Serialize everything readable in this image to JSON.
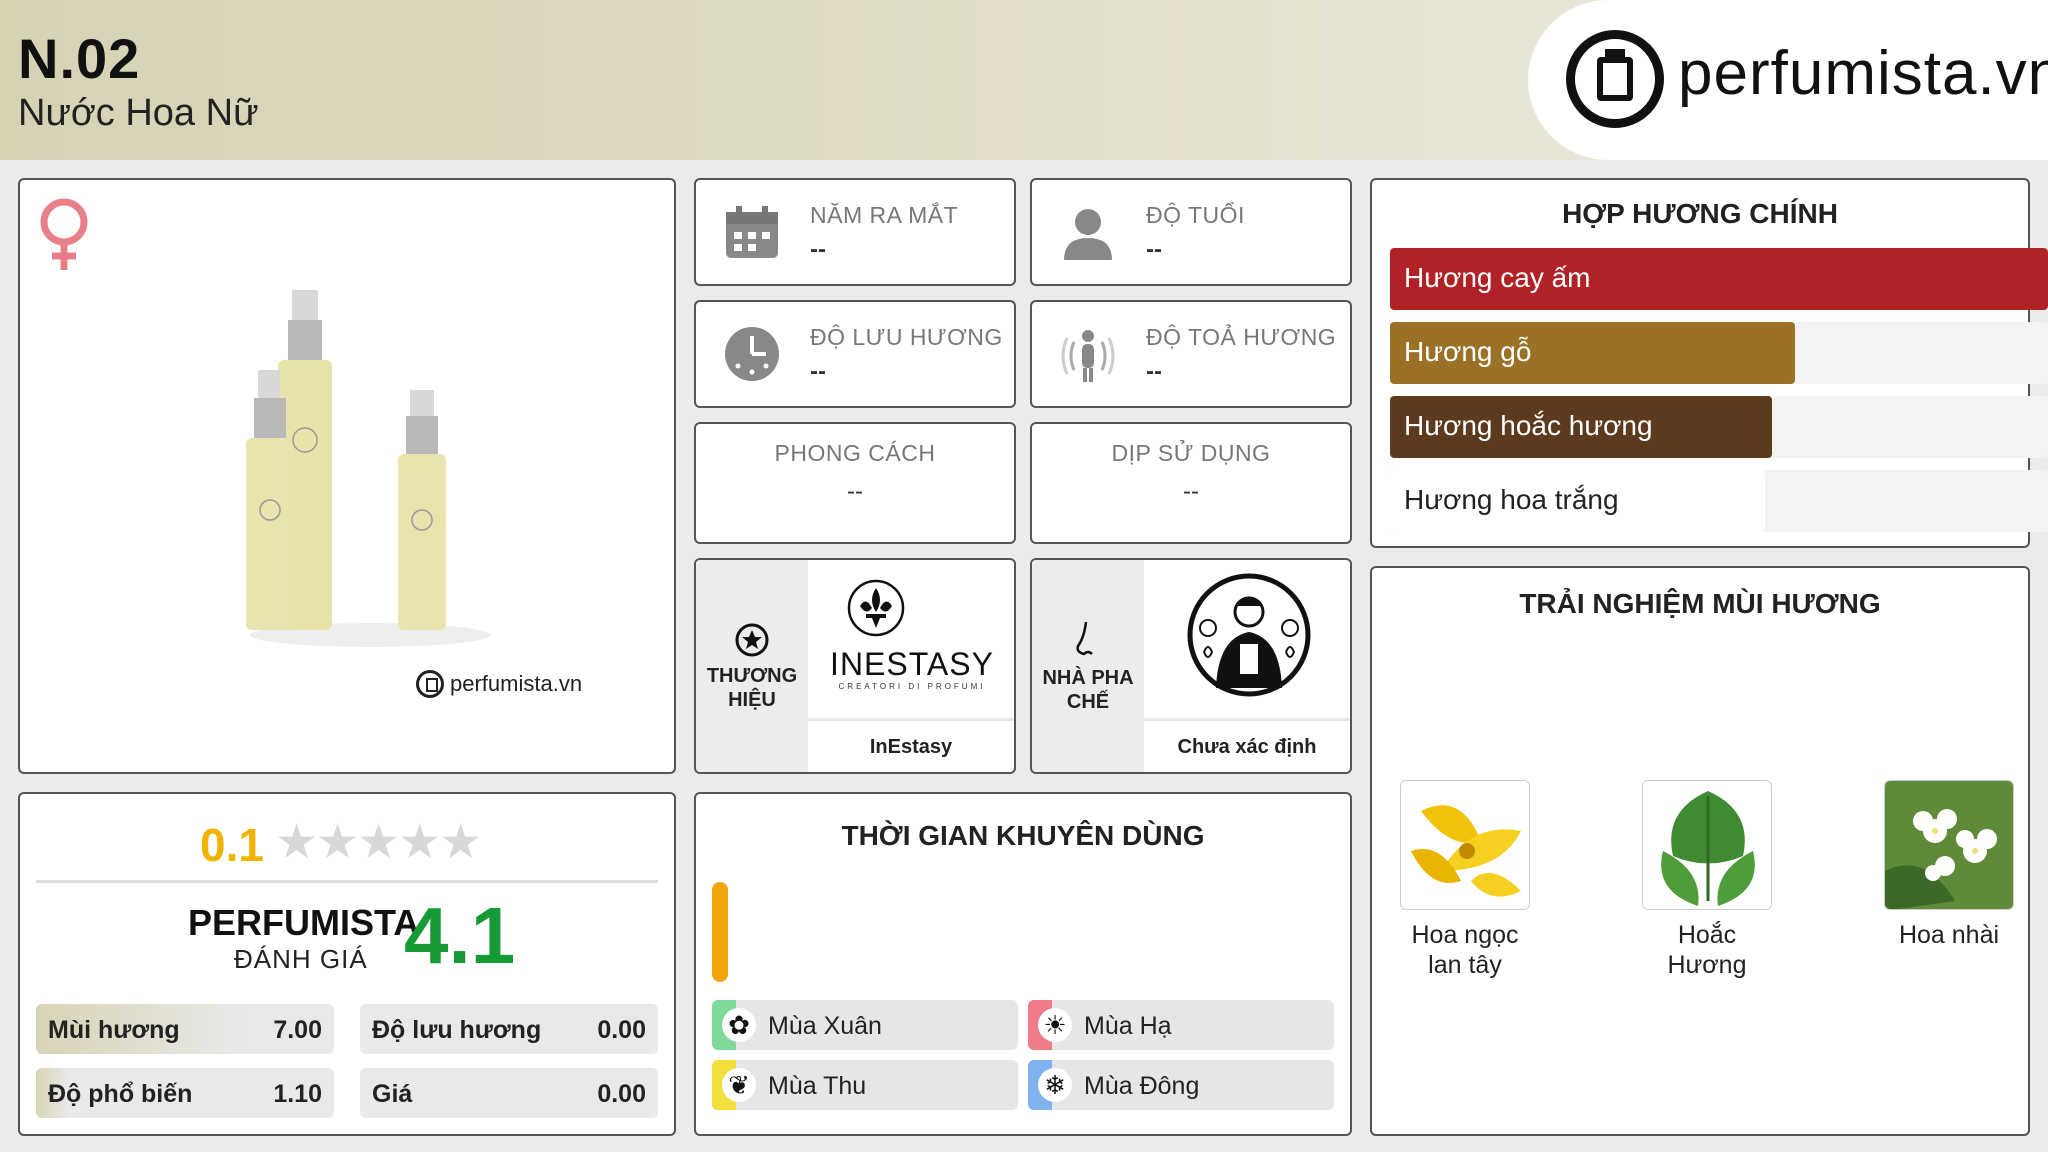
{
  "header": {
    "title": "N.02",
    "subtitle": "Nước Hoa Nữ",
    "logo_text": "perfumista.vn"
  },
  "product": {
    "gender_icon": "female-icon",
    "watermark": "perfumista.vn"
  },
  "info": {
    "release_label": "NĂM RA MẮT",
    "release_value": "--",
    "age_label": "ĐỘ TUỔI",
    "age_value": "--",
    "longevity_label": "ĐỘ LƯU HƯƠNG",
    "longevity_value": "--",
    "sillage_label": "ĐỘ TOẢ HƯƠNG",
    "sillage_value": "--",
    "style_label": "PHONG CÁCH",
    "style_value": "--",
    "occasion_label": "DỊP SỬ DỤNG",
    "occasion_value": "--"
  },
  "brand": {
    "label_line1": "THƯƠNG",
    "label_line2": "HIỆU",
    "logo_text": "INESTASY",
    "logo_sub": "CREATORI DI PROFUMI",
    "name": "InEstasy"
  },
  "perfumer": {
    "label_line1": "NHÀ PHA",
    "label_line2": "CHẾ",
    "name": "Chưa xác định"
  },
  "accords": {
    "title": "HỢP HƯƠNG CHÍNH",
    "items": [
      {
        "label": "Hương cay ấm",
        "value": 100,
        "color": "#b02226"
      },
      {
        "label": "Hương gỗ",
        "value": 61.5,
        "color": "#9a7127"
      },
      {
        "label": "Hương hoắc hương",
        "value": 58,
        "color": "#5b3a1e"
      },
      {
        "label": "Hương hoa trắng",
        "value": 57,
        "color": "#ffffff"
      }
    ]
  },
  "rating": {
    "user_rating": "0.1",
    "stars": "★★★★★",
    "perfumista_title": "PERFUMISTA",
    "perfumista_sub": "ĐÁNH GIÁ",
    "perfumista_score": "4.1",
    "stats": [
      {
        "label": "Mùi hương",
        "value": "7.00",
        "fraction": 0.7
      },
      {
        "label": "Độ lưu hương",
        "value": "0.00",
        "fraction": 0
      },
      {
        "label": "Độ phổ biến",
        "value": "1.10",
        "fraction": 0.11
      },
      {
        "label": "Giá",
        "value": "0.00",
        "fraction": 0
      }
    ]
  },
  "time": {
    "title": "THỜI GIAN KHUYÊN DÙNG",
    "seasons": [
      {
        "label": "Mùa Xuân",
        "color": "#7ed99a",
        "icon": "flower-icon"
      },
      {
        "label": "Mùa Hạ",
        "color": "#f27b8a",
        "icon": "sun-icon"
      },
      {
        "label": "Mùa Thu",
        "color": "#f2df3a",
        "icon": "leaf-icon"
      },
      {
        "label": "Mùa Đông",
        "color": "#7fb2ef",
        "icon": "snowflake-icon"
      }
    ]
  },
  "experience": {
    "title": "TRẢI NGHIỆM MÙI HƯƠNG",
    "notes": [
      {
        "line1": "Hoa ngọc",
        "line2": "lan tây"
      },
      {
        "line1": "Hoắc Hương",
        "line2": ""
      },
      {
        "line1": "Hoa nhài",
        "line2": ""
      }
    ]
  }
}
